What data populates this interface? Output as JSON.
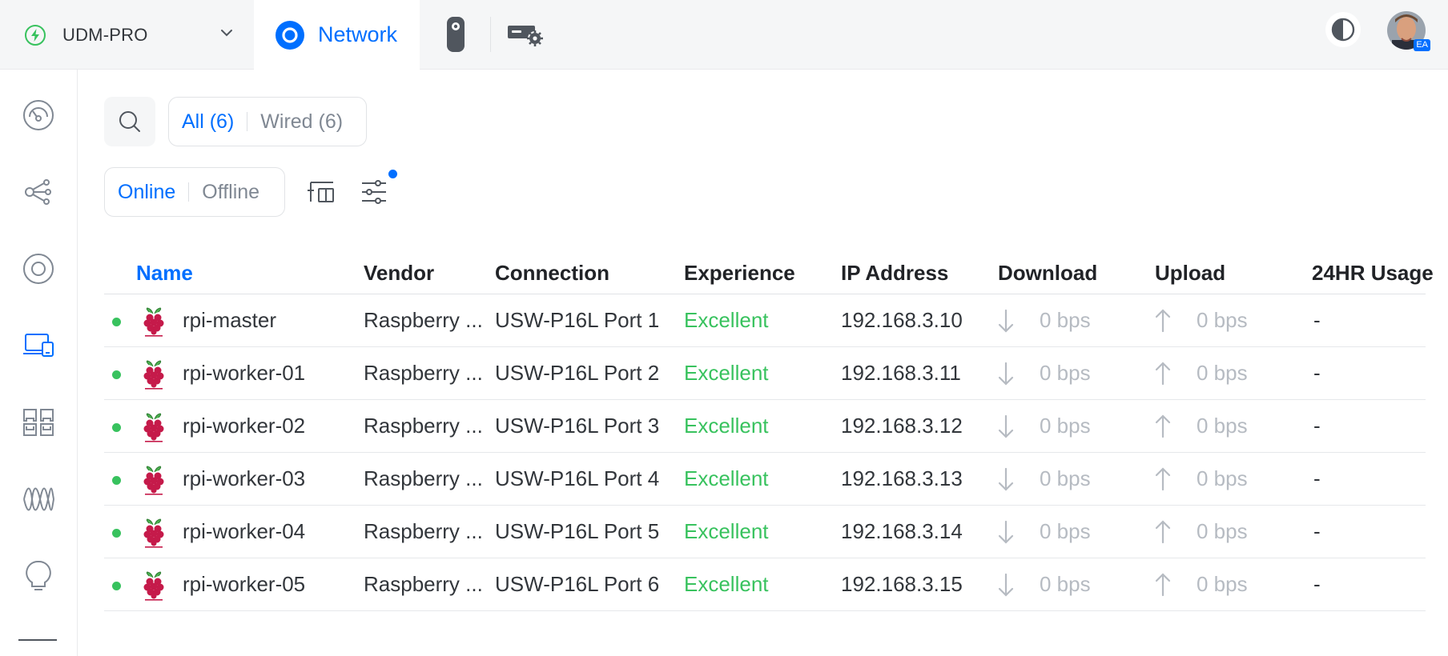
{
  "topbar": {
    "console_name": "UDM-PRO",
    "network_tab_label": "Network",
    "avatar_initials": "EA"
  },
  "sidenav": {
    "items": [
      {
        "name": "dashboard",
        "icon": "dashboard-gauge-icon",
        "active": false
      },
      {
        "name": "topology",
        "icon": "topology-icon",
        "active": false
      },
      {
        "name": "unifi-devices",
        "icon": "unifi-device-icon",
        "active": false
      },
      {
        "name": "client-devices",
        "icon": "client-devices-icon",
        "active": true
      },
      {
        "name": "ports",
        "icon": "ports-icon",
        "active": false
      },
      {
        "name": "insights",
        "icon": "waveform-icon",
        "active": false
      },
      {
        "name": "alarms",
        "icon": "lightbulb-icon",
        "active": false
      }
    ]
  },
  "filters": {
    "all_label": "All (6)",
    "wired_label": "Wired (6)",
    "online_label": "Online",
    "offline_label": "Offline"
  },
  "table": {
    "headers": {
      "name": "Name",
      "vendor": "Vendor",
      "connection": "Connection",
      "experience": "Experience",
      "ip": "IP Address",
      "download": "Download",
      "upload": "Upload",
      "usage": "24HR Usage"
    },
    "rows": [
      {
        "name": "rpi-master",
        "vendor": "Raspberry ...",
        "connection": "USW-P16L Port 1",
        "experience": "Excellent",
        "ip": "192.168.3.10",
        "download": "0 bps",
        "upload": "0 bps",
        "usage": "-",
        "status": "online"
      },
      {
        "name": "rpi-worker-01",
        "vendor": "Raspberry ...",
        "connection": "USW-P16L Port 2",
        "experience": "Excellent",
        "ip": "192.168.3.11",
        "download": "0 bps",
        "upload": "0 bps",
        "usage": "-",
        "status": "online"
      },
      {
        "name": "rpi-worker-02",
        "vendor": "Raspberry ...",
        "connection": "USW-P16L Port 3",
        "experience": "Excellent",
        "ip": "192.168.3.12",
        "download": "0 bps",
        "upload": "0 bps",
        "usage": "-",
        "status": "online"
      },
      {
        "name": "rpi-worker-03",
        "vendor": "Raspberry ...",
        "connection": "USW-P16L Port 4",
        "experience": "Excellent",
        "ip": "192.168.3.13",
        "download": "0 bps",
        "upload": "0 bps",
        "usage": "-",
        "status": "online"
      },
      {
        "name": "rpi-worker-04",
        "vendor": "Raspberry ...",
        "connection": "USW-P16L Port 5",
        "experience": "Excellent",
        "ip": "192.168.3.14",
        "download": "0 bps",
        "upload": "0 bps",
        "usage": "-",
        "status": "online"
      },
      {
        "name": "rpi-worker-05",
        "vendor": "Raspberry ...",
        "connection": "USW-P16L Port 6",
        "experience": "Excellent",
        "ip": "192.168.3.15",
        "download": "0 bps",
        "upload": "0 bps",
        "usage": "-",
        "status": "online"
      }
    ]
  },
  "colors": {
    "accent": "#006fff",
    "online": "#38c25e",
    "excellent": "#38c25e",
    "muted": "#b6bbc2"
  }
}
